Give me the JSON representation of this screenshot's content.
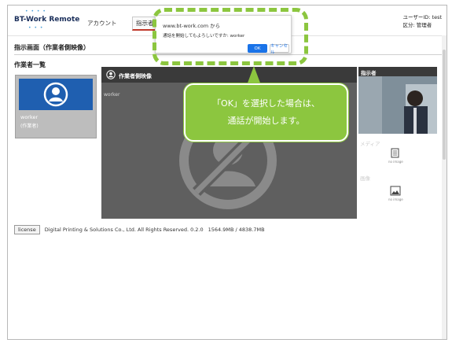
{
  "app": {
    "logo_text": "BT-Work Remote",
    "tabs": [
      {
        "label": "アカウント"
      },
      {
        "label": "指示者"
      }
    ],
    "user": {
      "id_line": "ユーザーID: test",
      "role_line": "区分: 管理者"
    }
  },
  "page": {
    "title": "指示画面（作業者側映像）",
    "worker_list_title": "作業者一覧",
    "worker": {
      "name": "worker",
      "status": "(作業者)"
    },
    "video_title": "作業者側映像",
    "video_worker_label": "worker"
  },
  "right_panel": {
    "title": "指示者",
    "label_media": "メディア",
    "label_image": "画像",
    "icon1_caption": "no image",
    "icon2_caption": "no image"
  },
  "footer": {
    "license_label": "license",
    "text": "Digital Printing & Solutions Co., Ltd. All Rights Reserved. 0.2.0",
    "memory": "1564.9MB / 4838.7MB"
  },
  "dialog": {
    "origin": "www.bt-work.com から",
    "message": "通話を開始してもよろしいですか: worker",
    "ok_label": "OK",
    "cancel_label": "キャンセル"
  },
  "callout": {
    "line1": "「OK」を選択した場合は、",
    "line2": "通話が開始します。"
  },
  "colors": {
    "accent_green": "#8cc63f",
    "ok_blue": "#1a73e8",
    "worker_blue": "#1f5fb0",
    "video_bg": "#5f5f5f"
  }
}
